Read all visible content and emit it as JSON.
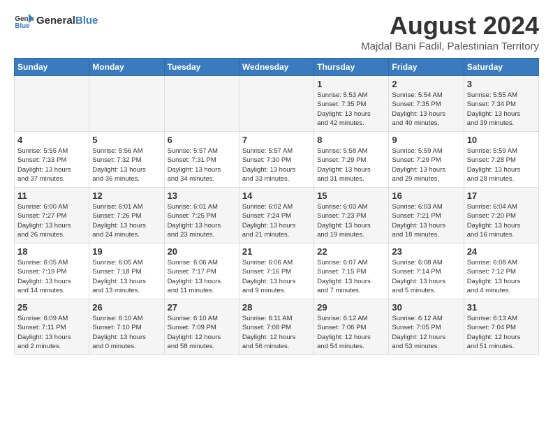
{
  "header": {
    "logo_general": "General",
    "logo_blue": "Blue",
    "title": "August 2024",
    "location": "Majdal Bani Fadil, Palestinian Territory"
  },
  "calendar": {
    "weekdays": [
      "Sunday",
      "Monday",
      "Tuesday",
      "Wednesday",
      "Thursday",
      "Friday",
      "Saturday"
    ],
    "weeks": [
      [
        {
          "day": "",
          "info": ""
        },
        {
          "day": "",
          "info": ""
        },
        {
          "day": "",
          "info": ""
        },
        {
          "day": "",
          "info": ""
        },
        {
          "day": "1",
          "info": "Sunrise: 5:53 AM\nSunset: 7:35 PM\nDaylight: 13 hours\nand 42 minutes."
        },
        {
          "day": "2",
          "info": "Sunrise: 5:54 AM\nSunset: 7:35 PM\nDaylight: 13 hours\nand 40 minutes."
        },
        {
          "day": "3",
          "info": "Sunrise: 5:55 AM\nSunset: 7:34 PM\nDaylight: 13 hours\nand 39 minutes."
        }
      ],
      [
        {
          "day": "4",
          "info": "Sunrise: 5:55 AM\nSunset: 7:33 PM\nDaylight: 13 hours\nand 37 minutes."
        },
        {
          "day": "5",
          "info": "Sunrise: 5:56 AM\nSunset: 7:32 PM\nDaylight: 13 hours\nand 36 minutes."
        },
        {
          "day": "6",
          "info": "Sunrise: 5:57 AM\nSunset: 7:31 PM\nDaylight: 13 hours\nand 34 minutes."
        },
        {
          "day": "7",
          "info": "Sunrise: 5:57 AM\nSunset: 7:30 PM\nDaylight: 13 hours\nand 33 minutes."
        },
        {
          "day": "8",
          "info": "Sunrise: 5:58 AM\nSunset: 7:29 PM\nDaylight: 13 hours\nand 31 minutes."
        },
        {
          "day": "9",
          "info": "Sunrise: 5:59 AM\nSunset: 7:29 PM\nDaylight: 13 hours\nand 29 minutes."
        },
        {
          "day": "10",
          "info": "Sunrise: 5:59 AM\nSunset: 7:28 PM\nDaylight: 13 hours\nand 28 minutes."
        }
      ],
      [
        {
          "day": "11",
          "info": "Sunrise: 6:00 AM\nSunset: 7:27 PM\nDaylight: 13 hours\nand 26 minutes."
        },
        {
          "day": "12",
          "info": "Sunrise: 6:01 AM\nSunset: 7:26 PM\nDaylight: 13 hours\nand 24 minutes."
        },
        {
          "day": "13",
          "info": "Sunrise: 6:01 AM\nSunset: 7:25 PM\nDaylight: 13 hours\nand 23 minutes."
        },
        {
          "day": "14",
          "info": "Sunrise: 6:02 AM\nSunset: 7:24 PM\nDaylight: 13 hours\nand 21 minutes."
        },
        {
          "day": "15",
          "info": "Sunrise: 6:03 AM\nSunset: 7:23 PM\nDaylight: 13 hours\nand 19 minutes."
        },
        {
          "day": "16",
          "info": "Sunrise: 6:03 AM\nSunset: 7:21 PM\nDaylight: 13 hours\nand 18 minutes."
        },
        {
          "day": "17",
          "info": "Sunrise: 6:04 AM\nSunset: 7:20 PM\nDaylight: 13 hours\nand 16 minutes."
        }
      ],
      [
        {
          "day": "18",
          "info": "Sunrise: 6:05 AM\nSunset: 7:19 PM\nDaylight: 13 hours\nand 14 minutes."
        },
        {
          "day": "19",
          "info": "Sunrise: 6:05 AM\nSunset: 7:18 PM\nDaylight: 13 hours\nand 13 minutes."
        },
        {
          "day": "20",
          "info": "Sunrise: 6:06 AM\nSunset: 7:17 PM\nDaylight: 13 hours\nand 11 minutes."
        },
        {
          "day": "21",
          "info": "Sunrise: 6:06 AM\nSunset: 7:16 PM\nDaylight: 13 hours\nand 9 minutes."
        },
        {
          "day": "22",
          "info": "Sunrise: 6:07 AM\nSunset: 7:15 PM\nDaylight: 13 hours\nand 7 minutes."
        },
        {
          "day": "23",
          "info": "Sunrise: 6:08 AM\nSunset: 7:14 PM\nDaylight: 13 hours\nand 5 minutes."
        },
        {
          "day": "24",
          "info": "Sunrise: 6:08 AM\nSunset: 7:12 PM\nDaylight: 13 hours\nand 4 minutes."
        }
      ],
      [
        {
          "day": "25",
          "info": "Sunrise: 6:09 AM\nSunset: 7:11 PM\nDaylight: 13 hours\nand 2 minutes."
        },
        {
          "day": "26",
          "info": "Sunrise: 6:10 AM\nSunset: 7:10 PM\nDaylight: 13 hours\nand 0 minutes."
        },
        {
          "day": "27",
          "info": "Sunrise: 6:10 AM\nSunset: 7:09 PM\nDaylight: 12 hours\nand 58 minutes."
        },
        {
          "day": "28",
          "info": "Sunrise: 6:11 AM\nSunset: 7:08 PM\nDaylight: 12 hours\nand 56 minutes."
        },
        {
          "day": "29",
          "info": "Sunrise: 6:12 AM\nSunset: 7:06 PM\nDaylight: 12 hours\nand 54 minutes."
        },
        {
          "day": "30",
          "info": "Sunrise: 6:12 AM\nSunset: 7:05 PM\nDaylight: 12 hours\nand 53 minutes."
        },
        {
          "day": "31",
          "info": "Sunrise: 6:13 AM\nSunset: 7:04 PM\nDaylight: 12 hours\nand 51 minutes."
        }
      ]
    ]
  }
}
